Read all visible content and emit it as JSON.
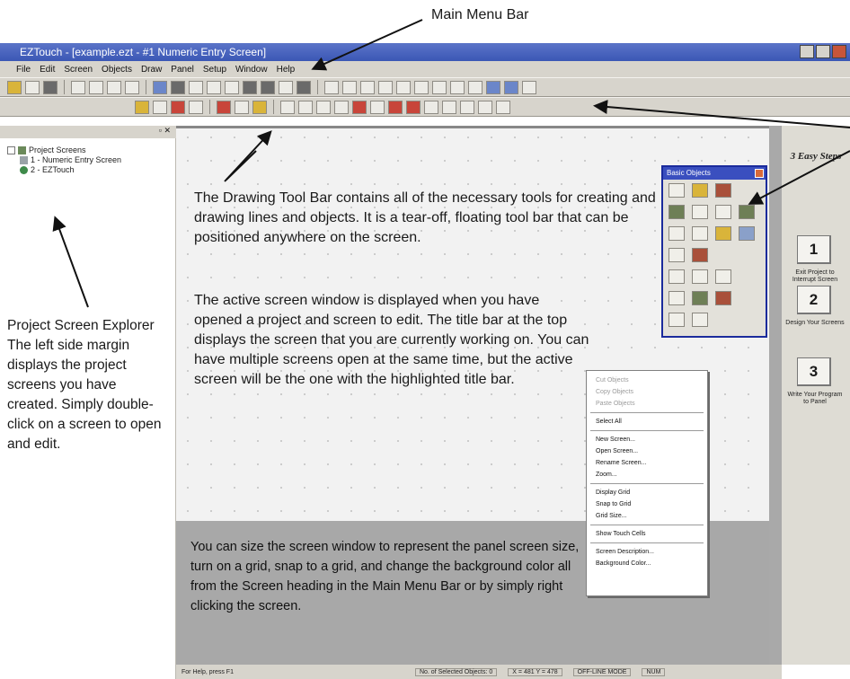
{
  "window": {
    "title": "EZTouch - [example.ezt - #1 Numeric Entry Screen]"
  },
  "menu": {
    "items": [
      "File",
      "Edit",
      "Screen",
      "Objects",
      "Draw",
      "Panel",
      "Setup",
      "Window",
      "Help"
    ]
  },
  "explorer": {
    "header": "",
    "root": "Project Screens",
    "screens": [
      "1 - Numeric Entry Screen",
      "2 - EZTouch"
    ]
  },
  "palette": {
    "title": "Basic Objects"
  },
  "steps": {
    "title": "3 Easy Steps",
    "items": [
      {
        "number": "1",
        "caption": "Exit Project to Interrupt Screen"
      },
      {
        "number": "2",
        "caption": "Design Your Screens"
      },
      {
        "number": "3",
        "caption": "Write Your Program to Panel"
      }
    ]
  },
  "context_menu": {
    "items": [
      {
        "label": "Cut Objects",
        "disabled": true
      },
      {
        "label": "Copy Objects",
        "disabled": true
      },
      {
        "label": "Paste Objects",
        "disabled": true
      },
      {
        "sep": true
      },
      {
        "label": "Select All",
        "disabled": false
      },
      {
        "sep": true
      },
      {
        "label": "New Screen...",
        "disabled": false
      },
      {
        "label": "Open Screen...",
        "disabled": false
      },
      {
        "label": "Rename Screen...",
        "disabled": false
      },
      {
        "label": "Zoom...",
        "disabled": false
      },
      {
        "sep": true
      },
      {
        "label": "Display Grid",
        "disabled": false
      },
      {
        "label": "Snap to Grid",
        "disabled": false
      },
      {
        "label": "Grid Size...",
        "disabled": false
      },
      {
        "sep": true
      },
      {
        "label": "Show Touch Cells",
        "disabled": false
      },
      {
        "sep": true
      },
      {
        "label": "Screen Description...",
        "disabled": false
      },
      {
        "label": "Background Color...",
        "disabled": false
      }
    ]
  },
  "status": {
    "help": "For Help, press F1",
    "selected": "No. of Selected Objects: 0",
    "coords": "X = 481  Y = 478",
    "mode": "OFF-LINE MODE",
    "num": "NUM"
  },
  "annotations": {
    "main_menu": "Main Menu Bar",
    "drawing_toolbar": "The Drawing Tool Bar contains all of the necessary tools for creating and drawing lines and objects. It is a tear-off, floating tool bar that can be positioned anywhere on the screen.",
    "active_screen": "The active screen window is displayed when you have opened a project and screen to edit. The title bar at the top displays the screen that you are currently working on. You can have multiple screens open at the same time, but the active screen will be the one with the highlighted title bar.",
    "explorer": "Project Screen Explorer The left side margin displays the project screens you have created. Simply double-click on a screen to open and edit.",
    "screen_sizing": "You can size the screen window to represent the panel screen size, turn on a grid, snap to a grid, and change the background color all from the Screen heading in the Main Menu Bar or by simply right clicking the screen."
  }
}
